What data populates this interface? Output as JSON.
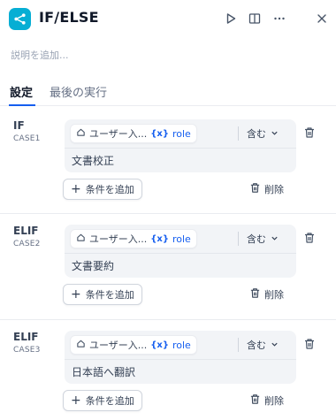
{
  "header": {
    "title": "IF/ELSE",
    "icons": [
      "branch-icon",
      "play-icon",
      "split-view-icon",
      "more-icon",
      "close-icon"
    ]
  },
  "description_placeholder": "説明を追加...",
  "tabs": [
    {
      "label": "設定",
      "active": true
    },
    {
      "label": "最後の実行",
      "active": false
    }
  ],
  "cases": [
    {
      "label": "IF",
      "sub": "CASE1",
      "condition": {
        "node": "ユーザー入...",
        "var_prefix": "{x}",
        "variable": "role",
        "operator": "含む",
        "value": "文書校正"
      },
      "add_label": "条件を追加",
      "delete_label": "削除"
    },
    {
      "label": "ELIF",
      "sub": "CASE2",
      "condition": {
        "node": "ユーザー入...",
        "var_prefix": "{x}",
        "variable": "role",
        "operator": "含む",
        "value": "文書要約"
      },
      "add_label": "条件を追加",
      "delete_label": "削除"
    },
    {
      "label": "ELIF",
      "sub": "CASE3",
      "condition": {
        "node": "ユーザー入...",
        "var_prefix": "{x}",
        "variable": "role",
        "operator": "含む",
        "value": "日本語へ翻訳"
      },
      "add_label": "条件を追加",
      "delete_label": "削除"
    }
  ],
  "colors": {
    "accent": "#155eef",
    "node_icon_bg": "#06aed4",
    "condition_bg": "#f2f4f7"
  }
}
